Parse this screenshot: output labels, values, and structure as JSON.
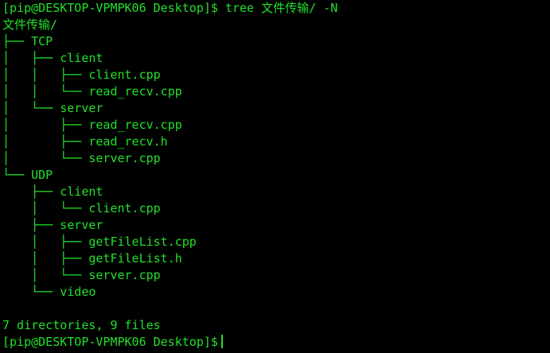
{
  "terminal": {
    "command_line": "[pip@DESKTOP-VPMPK06 Desktop]$ tree 文件传输/ -N",
    "root": "文件传输/",
    "tree_lines": [
      "├── TCP",
      "│   ├── client",
      "│   │   ├── client.cpp",
      "│   │   └── read_recv.cpp",
      "│   └── server",
      "│       ├── read_recv.cpp",
      "│       ├── read_recv.h",
      "│       └── server.cpp",
      "└── UDP",
      "    ├── client",
      "    │   └── client.cpp",
      "    ├── server",
      "    │   ├── getFileList.cpp",
      "    │   ├── getFileList.h",
      "    │   └── server.cpp",
      "    └── video"
    ],
    "summary": "7 directories, 9 files",
    "final_prompt": "[pip@DESKTOP-VPMPK06 Desktop]$",
    "text_color": "#22e02a",
    "background_color": "#000000"
  }
}
